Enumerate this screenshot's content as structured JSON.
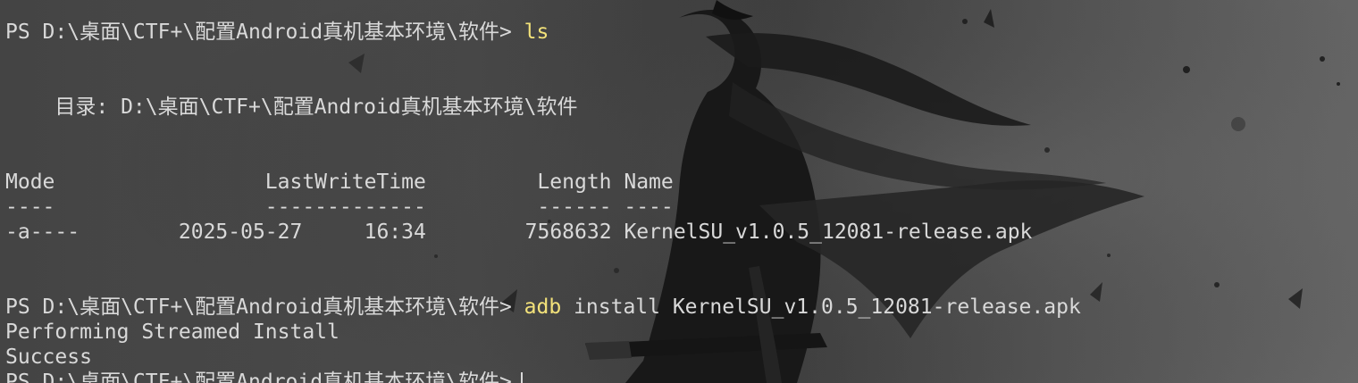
{
  "terminal": {
    "prompt": "PS D:\\桌面\\CTF+\\配置Android真机基本环境\\软件>",
    "line1_command": "ls",
    "directory_line": "    目录: D:\\桌面\\CTF+\\配置Android真机基本环境\\软件",
    "table_header": "Mode                 LastWriteTime         Length Name",
    "table_divider": "----                 -------------         ------ ----",
    "table_rows": [
      {
        "mode": "-a----",
        "date": "2025-05-27",
        "time": "16:34",
        "length": "7568632",
        "name": "KernelSU_v1.0.5_12081-release.apk"
      }
    ],
    "command_prefix": "adb",
    "command_rest": "install KernelSU_v1.0.5_12081-release.apk",
    "output_lines": [
      "Performing Streamed Install",
      "Success"
    ]
  }
}
